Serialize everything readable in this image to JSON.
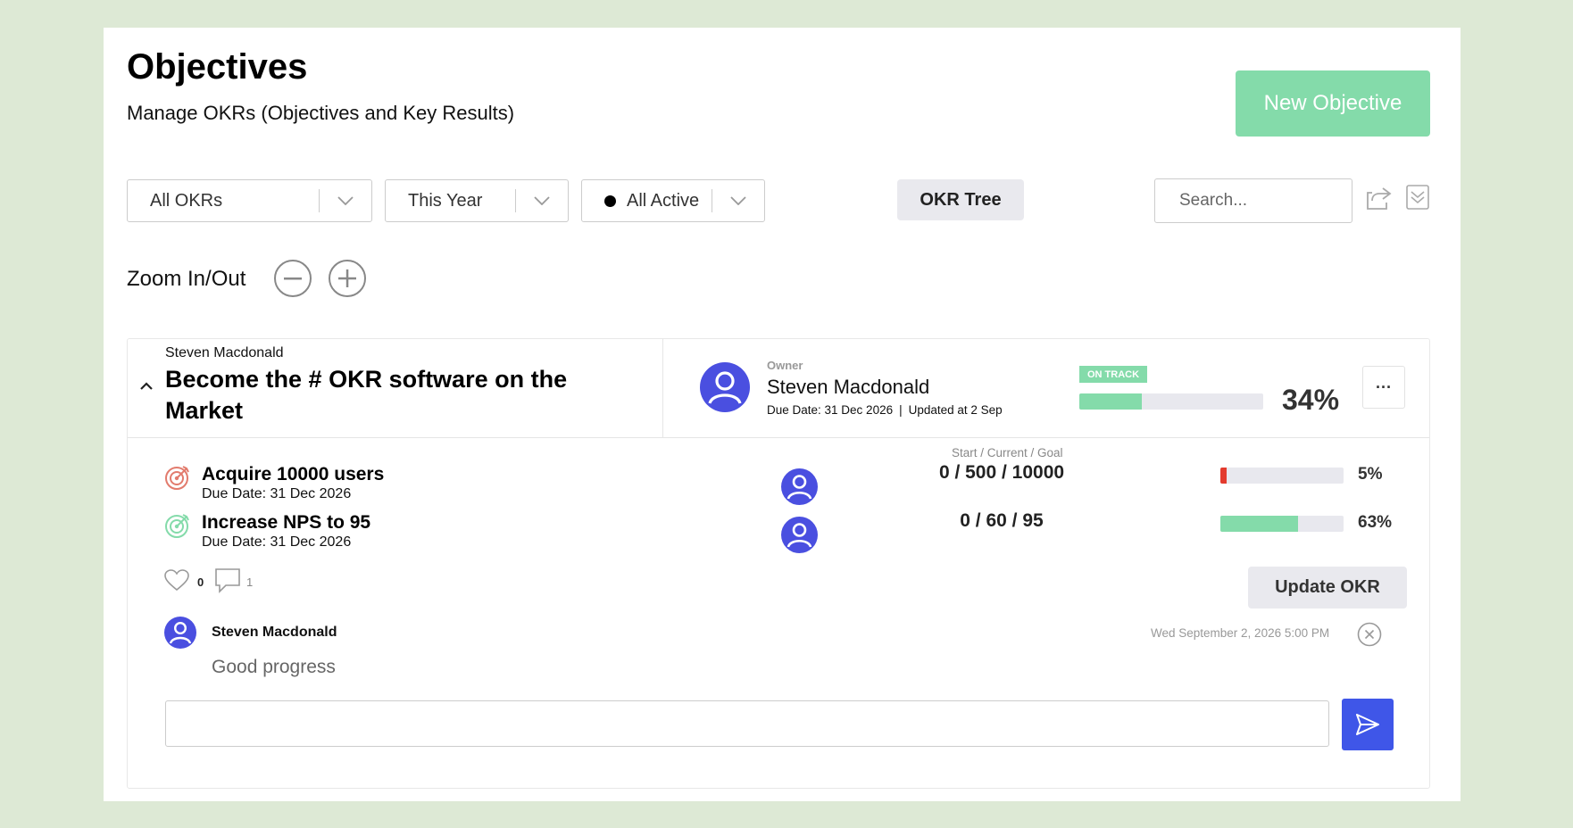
{
  "header": {
    "title": "Objectives",
    "subtitle": "Manage OKRs (Objectives and Key Results)",
    "new_button": "New Objective"
  },
  "filters": {
    "okr_scope": "All OKRs",
    "period": "This Year",
    "status": "All Active",
    "tree_button": "OKR Tree",
    "search_placeholder": "Search..."
  },
  "zoom": {
    "label": "Zoom In/Out"
  },
  "objective": {
    "author": "Steven Macdonald",
    "title_line1": "Become the # OKR software on the",
    "title_line2": "Market",
    "owner_label": "Owner",
    "owner_name": "Steven Macdonald",
    "due_meta": "Due Date: 31 Dec 2026",
    "updated_meta": "Updated at 2 Sep",
    "status_badge": "ON TRACK",
    "progress_percent": 34,
    "progress_text": "34%",
    "more_label": "···",
    "colors": {
      "accent_green": "#84dbaa",
      "avatar_blue": "#4a4fe0",
      "send_blue": "#3f56e8",
      "progress_red": "#e33b2e"
    }
  },
  "key_results": {
    "header": "Start / Current / Goal",
    "items": [
      {
        "title": "Acquire 10000 users",
        "due": "Due Date: 31 Dec 2026",
        "values": "0 / 500 / 10000",
        "percent": 5,
        "percent_text": "5%",
        "icon": "target-icon-red"
      },
      {
        "title": "Increase NPS to 95",
        "due": "Due Date: 31 Dec 2026",
        "values": "0 / 60 / 95",
        "percent": 63,
        "percent_text": "63%",
        "icon": "target-icon-green"
      }
    ]
  },
  "engagement": {
    "likes": "0",
    "comments": "1",
    "update_button": "Update OKR"
  },
  "comment": {
    "author": "Steven Macdonald",
    "timestamp": "Wed September 2, 2026 5:00 PM",
    "text": "Good progress"
  }
}
